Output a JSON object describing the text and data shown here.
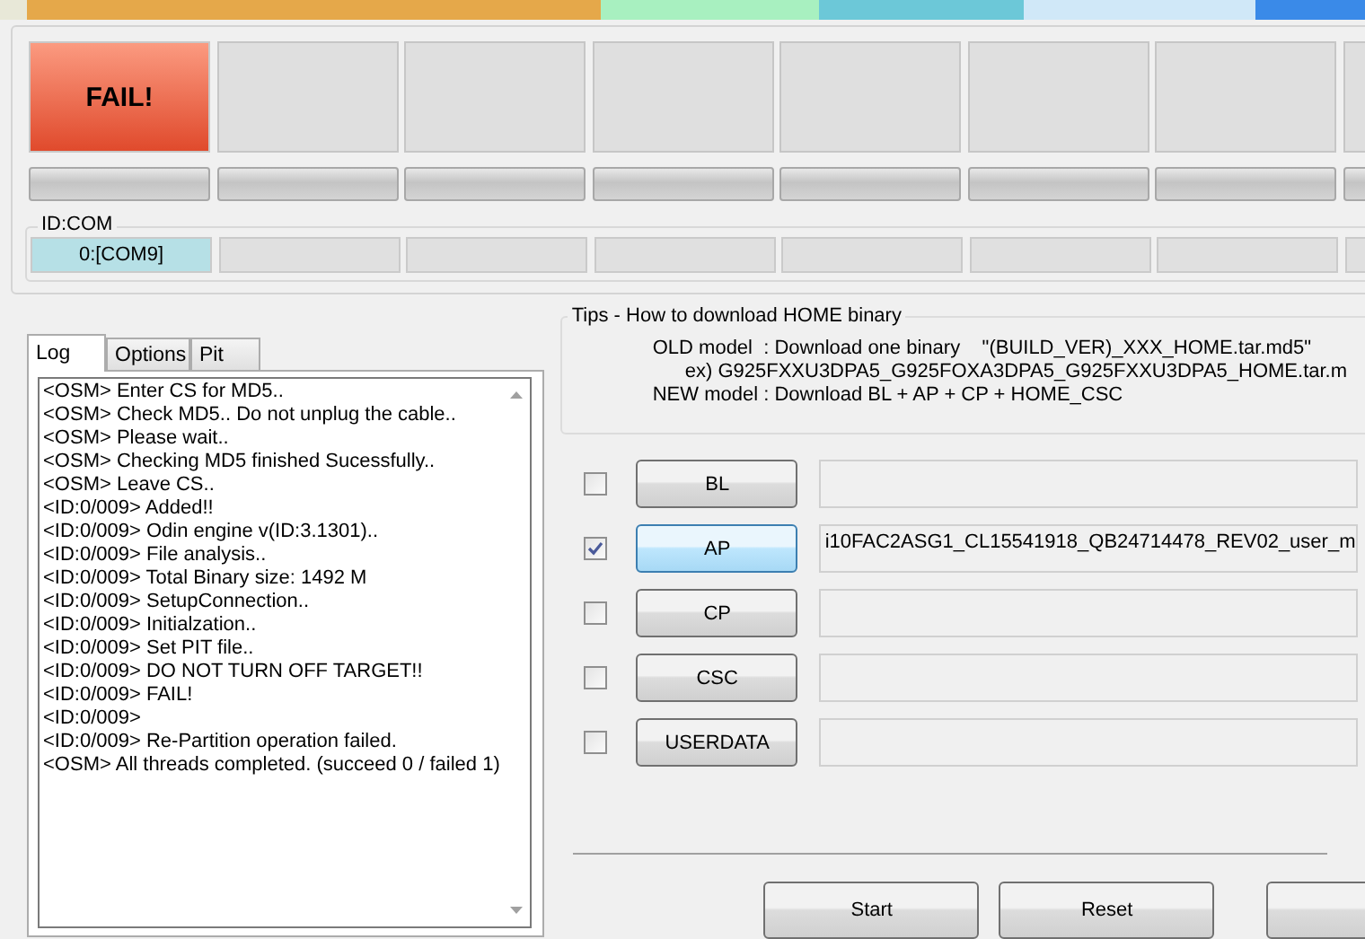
{
  "slots": [
    {
      "failed": true,
      "label": "FAIL!",
      "level": 0,
      "port": "0:[COM9]",
      "connected": true
    },
    {
      "failed": false,
      "level": 0,
      "connected": false
    },
    {
      "failed": false,
      "level": 0,
      "connected": false
    },
    {
      "failed": false,
      "level": 0,
      "connected": false
    },
    {
      "failed": false,
      "level": 0,
      "connected": false
    },
    {
      "failed": false,
      "level": 0,
      "connected": false
    },
    {
      "failed": false,
      "level": 0,
      "connected": false
    },
    {
      "failed": false,
      "level": 0,
      "connected": false
    }
  ],
  "id_com_label": "ID:COM",
  "tabs": [
    {
      "label": "Log",
      "selected": true
    },
    {
      "label": "Options",
      "selected": false
    },
    {
      "label": "Pit",
      "selected": false
    }
  ],
  "log": [
    "<OSM> Enter CS for MD5..",
    "<OSM> Check MD5.. Do not unplug the cable..",
    "<OSM> Please wait..",
    "<OSM> Checking MD5 finished Sucessfully..",
    "<OSM> Leave CS..",
    "<ID:0/009> Added!!",
    "<ID:0/009> Odin engine v(ID:3.1301)..",
    "<ID:0/009> File analysis..",
    "<ID:0/009> Total Binary size: 1492 M",
    "<ID:0/009> SetupConnection..",
    "<ID:0/009> Initialzation..",
    "<ID:0/009> Set PIT file..",
    "<ID:0/009> DO NOT TURN OFF TARGET!!",
    "<ID:0/009> FAIL!",
    "<ID:0/009>",
    "<ID:0/009> Re-Partition operation failed.",
    "<OSM> All threads completed. (succeed 0 / failed 1)"
  ],
  "tips": {
    "title": "Tips - How to download HOME binary",
    "lines": [
      "OLD model  : Download one binary    \"(BUILD_VER)_XXX_HOME.tar.md5\"",
      "ex) G925FXXU3DPA5_G925FOXA3DPA5_G925FXXU3DPA5_HOME.tar.m",
      "NEW model : Download BL + AP + CP + HOME_CSC"
    ]
  },
  "files": [
    {
      "label": "BL",
      "checked": false,
      "selected": false
    },
    {
      "label": "AP",
      "checked": true,
      "selected": true,
      "path": "i10FAC2ASG1_CL15541918_QB24714478_REV02_user_m"
    },
    {
      "label": "CP",
      "checked": false,
      "selected": false
    },
    {
      "label": "CSC",
      "checked": false,
      "selected": false
    },
    {
      "label": "USERDATA",
      "checked": false,
      "selected": false
    }
  ],
  "buttons": [
    "Start",
    "Reset"
  ]
}
